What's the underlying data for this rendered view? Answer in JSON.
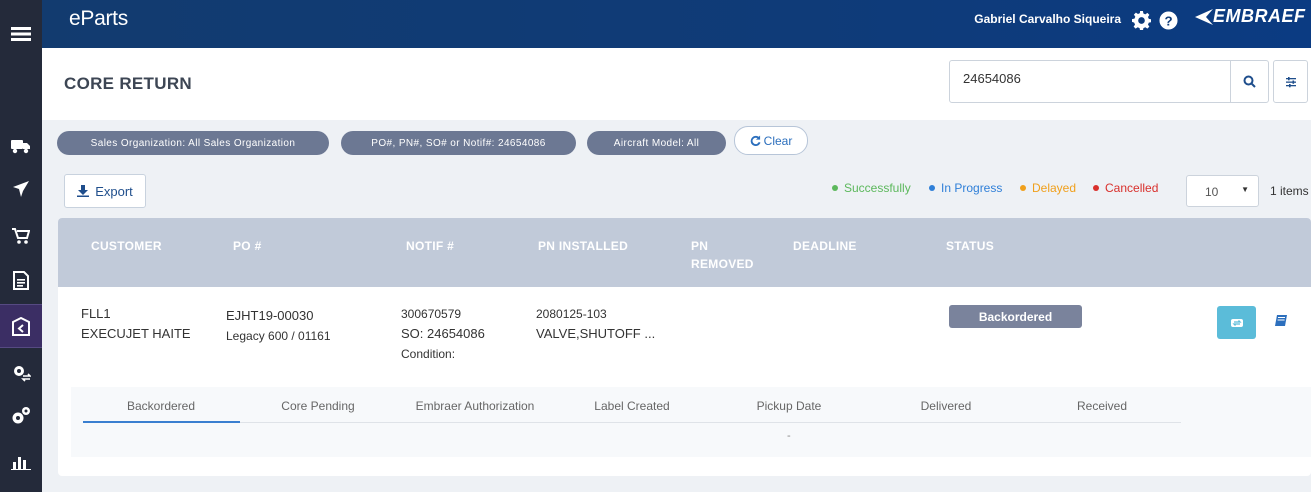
{
  "app": {
    "brand": "eParts",
    "user_name": "Gabriel Carvalho Siqueira",
    "logo_text": "EMBRAEF"
  },
  "sidebar": {
    "items": [
      {
        "name": "menu-icon"
      },
      {
        "name": "truck-icon"
      },
      {
        "name": "airplane-icon"
      },
      {
        "name": "cart-icon"
      },
      {
        "name": "document-icon"
      },
      {
        "name": "core-return-icon",
        "active": true
      },
      {
        "name": "exchange-gear-icon"
      },
      {
        "name": "gears-icon"
      },
      {
        "name": "bar-chart-icon"
      }
    ]
  },
  "page": {
    "title": "CORE RETURN"
  },
  "search": {
    "value": "24654086"
  },
  "filters": {
    "chips": [
      "Sales Organization: All Sales Organization",
      "PO#, PN#, SO# or Notif#: 24654086",
      "Aircraft Model: All"
    ],
    "clear_label": "Clear"
  },
  "toolbar": {
    "export_label": "Export",
    "page_size": "10",
    "items_count": "1 items"
  },
  "legend": [
    {
      "label": "Successfully",
      "color": "#5cb85c"
    },
    {
      "label": "In Progress",
      "color": "#2f7fd8"
    },
    {
      "label": "Delayed",
      "color": "#f0a01c"
    },
    {
      "label": "Cancelled",
      "color": "#d9302c"
    }
  ],
  "table": {
    "headers": {
      "customer": "CUSTOMER",
      "po": "PO #",
      "notif": "NOTIF #",
      "pn_installed": "PN INSTALLED",
      "pn_removed_1": "PN",
      "pn_removed_2": "REMOVED",
      "deadline": "DEADLINE",
      "status": "STATUS"
    },
    "rows": [
      {
        "customer_code": "FLL1",
        "customer_name": "EXECUJET HAITE",
        "po": "EJHT19-00030",
        "aircraft": "Legacy 600 / 01161",
        "notif": "300670579",
        "so": "SO: 24654086",
        "condition": "Condition:",
        "pn_installed": "2080125-103",
        "pn_description": "VALVE,SHUTOFF ...",
        "status": "Backordered"
      }
    ],
    "steps": [
      "Backordered",
      "Core Pending",
      "Embraer Authorization",
      "Label Created",
      "Pickup Date",
      "Delivered",
      "Received"
    ],
    "step_value": "-"
  }
}
